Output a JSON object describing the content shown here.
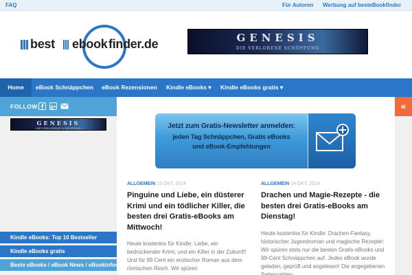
{
  "topbar": {
    "faq": "FAQ",
    "authors": "Für Autoren",
    "advertising": "Werbung auf besteBookfinder"
  },
  "logo": {
    "part1": "best",
    "part2": "ebook",
    "part3": "finder.de"
  },
  "banner": {
    "title": "GENESIS",
    "subtitle": "DIE VERLORENE SCHÖPFUNG"
  },
  "nav": {
    "items": [
      {
        "label": "Home",
        "active": true
      },
      {
        "label": "eBook Schnäppchen"
      },
      {
        "label": "eBook Rezensionen"
      },
      {
        "label": "Kindle eBooks ▾"
      },
      {
        "label": "Kindle eBooks gratis ▾"
      }
    ]
  },
  "sidebar": {
    "follow_label": "FOLLOW:",
    "links": [
      "Kindle eBooks: Top 10 Bestseller",
      "Kindle eBooks gratis",
      "Beste eBooks / eBook News / eBookinfos"
    ]
  },
  "newsletter": {
    "line1": "Jetzt zum Gratis-Newsletter anmelden:",
    "line2": "jeden Tag Schnäppchen, Gratis eBooks",
    "line3": "und eBook-Empfehlungen"
  },
  "posts": [
    {
      "category": "ALLGEMEIN",
      "date": "15 OKT, 2014",
      "title": "Pinguine und Liebe, ein düsterer Krimi und ein tödlicher Killer, die besten drei Gratis-eBooks am Mittwoch!",
      "excerpt": "Heute kostenlos für Kindle: Liebe, ein bedrückender Krimi, und ein Killer in der Zukunft! Und für 99 Cent ein erotischer Roman aus dem römischen Reich. Wir spüren"
    },
    {
      "category": "ALLGEMEIN",
      "date": "14 OKT, 2014",
      "title": "Drachen und Magie-Rezepte - die besten drei Gratis-eBooks am Dienstag!",
      "excerpt": "Heute kostenlos für Kindle: Drachen-Fantasy, historischer Jugendroman und magische Rezepte! Wir spüren stets nur die besten Gratis-eBooks und 99-Cent Schnäppchen auf. Jedes eBook wurde geladen, geprüft und angelesen! Die angegebenen Seitenzahlen"
    }
  ],
  "colors": {
    "brand": "#2a77c9",
    "accent_light": "#4ea3d9",
    "toggle": "#f06a3c"
  }
}
